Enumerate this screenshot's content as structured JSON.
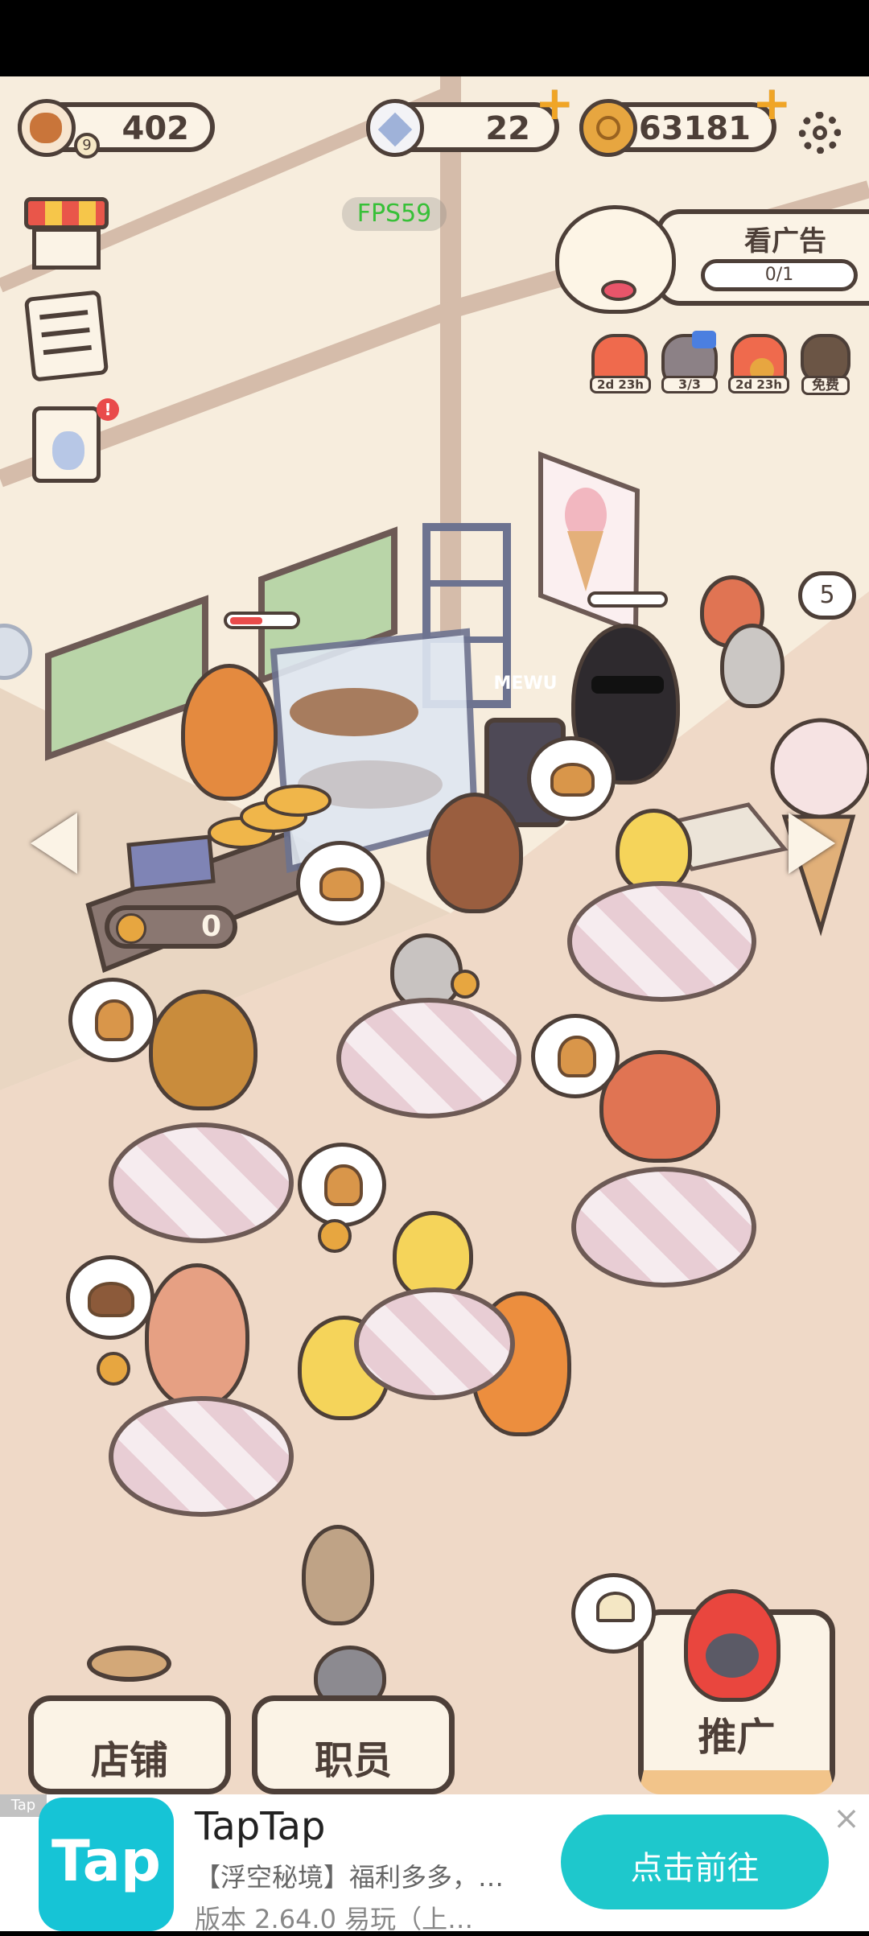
{
  "hud": {
    "bread_count": "402",
    "bread_level": "9",
    "gems": "22",
    "coins": "63181",
    "fps": "FPS59"
  },
  "ad_panel": {
    "title": "看广告",
    "progress": "0/1",
    "progress_fraction": 0
  },
  "boosts": [
    {
      "icon": "fire-cat-icon",
      "label": "2d 23h"
    },
    {
      "icon": "video-pack-icon",
      "label": "3/3"
    },
    {
      "icon": "fire-coins-icon",
      "label": "2d 23h"
    },
    {
      "icon": "free-gift-icon",
      "label": "免费"
    }
  ],
  "shop": {
    "sign_text": "MEWU",
    "register_coins": "0",
    "queue_count": "5"
  },
  "bottom_nav": {
    "store": "店铺",
    "staff": "职员",
    "promote": "推广"
  },
  "ad": {
    "tag": "Tap",
    "app_name": "TapTap",
    "description": "【浮空秘境】福利多多，…",
    "version": "版本 2.64.0  易玩（上…",
    "cta": "点击前往",
    "logo_text": "Tap"
  },
  "colors": {
    "outline": "#4d3f38",
    "accent_orange": "#f0a526",
    "ad_button": "#1ec8cc"
  }
}
